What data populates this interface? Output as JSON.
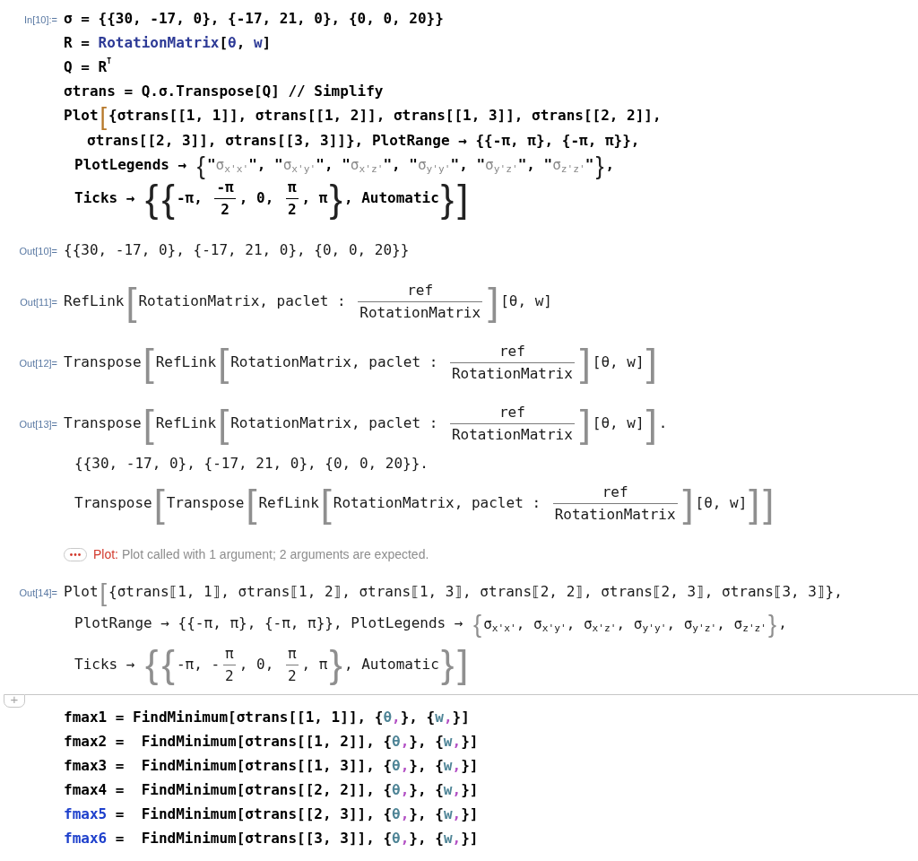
{
  "cells": [
    {
      "kind": "input",
      "label": "In[10]:=",
      "lines": [
        {
          "kind": "first",
          "segments": [
            {
              "kind": "code",
              "text": "σ = {{30, -17, 0}, {-17, 21, 0}, {0, 0, 20}}"
            }
          ]
        },
        {
          "kind": "first",
          "segments": [
            {
              "kind": "code",
              "text": "R = "
            },
            {
              "kind": "builtin",
              "text": "RotationMatrix"
            },
            {
              "kind": "code",
              "text": "["
            },
            {
              "kind": "symbol",
              "text": "θ"
            },
            {
              "kind": "code",
              "text": ", "
            },
            {
              "kind": "symbol",
              "text": "w"
            },
            {
              "kind": "code",
              "text": "]"
            }
          ]
        },
        {
          "kind": "first",
          "segments": [
            {
              "kind": "code",
              "text": "Q = R$^{T}$"
            }
          ]
        },
        {
          "kind": "first",
          "segments": [
            {
              "kind": "code",
              "text": "σtrans = Q.σ.Transpose[Q] // Simplify"
            }
          ]
        },
        {
          "kind": "first",
          "segments": [
            {
              "kind": "code",
              "text": "Plot"
            },
            {
              "kind": "match",
              "text": "["
            },
            {
              "kind": "code",
              "text": "{σtrans[[1, 1]], σtrans[[1, 2]], σtrans[[1, 3]], σtrans[[2, 2]],"
            }
          ]
        },
        {
          "kind": "deep",
          "segments": [
            {
              "kind": "code",
              "text": "σtrans[[2, 3]], σtrans[[3, 3]]}, PlotRange → {{-π, π}, {-π, π}},"
            }
          ]
        },
        {
          "kind": "wrap",
          "segments": [
            {
              "kind": "code",
              "text": "PlotLegends → "
            },
            {
              "kind": "bracket",
              "text": "{"
            },
            {
              "kind": "code",
              "text": "\""
            },
            {
              "kind": "string",
              "text": "σ$_{x'x'}$"
            },
            {
              "kind": "code",
              "text": "\", \""
            },
            {
              "kind": "string",
              "text": "σ$_{x'y'}$"
            },
            {
              "kind": "code",
              "text": "\", \""
            },
            {
              "kind": "string",
              "text": "σ$_{x'z'}$"
            },
            {
              "kind": "code",
              "text": "\", \""
            },
            {
              "kind": "string",
              "text": "σ$_{y'y'}$"
            },
            {
              "kind": "code",
              "text": "\", \""
            },
            {
              "kind": "string",
              "text": "σ$_{y'z'}$"
            },
            {
              "kind": "code",
              "text": "\", \""
            },
            {
              "kind": "string",
              "text": "σ$_{z'z'}$"
            },
            {
              "kind": "code",
              "text": "\""
            },
            {
              "kind": "bracket",
              "text": "}"
            },
            {
              "kind": "code",
              "text": ","
            }
          ]
        },
        {
          "kind": "wrap",
          "segments": [
            {
              "kind": "code",
              "text": "Ticks → "
            },
            {
              "kind": "bracket",
              "text": "{"
            },
            {
              "kind": "bracket",
              "text": "{"
            },
            {
              "kind": "code",
              "text": "-π, "
            },
            {
              "kind": "frac",
              "numerator": "-π",
              "denominator": "2"
            },
            {
              "kind": "code",
              "text": ", 0, "
            },
            {
              "kind": "frac",
              "numerator": "π",
              "denominator": "2"
            },
            {
              "kind": "code",
              "text": ", π"
            },
            {
              "kind": "bracket",
              "text": "}"
            },
            {
              "kind": "code",
              "text": ", Automatic"
            },
            {
              "kind": "bracket",
              "text": "}"
            },
            {
              "kind": "bracket",
              "text": "]"
            }
          ]
        }
      ]
    },
    {
      "kind": "output",
      "label": "Out[10]=",
      "lines": [
        {
          "kind": "first",
          "segments": [
            {
              "kind": "code",
              "text": "{{30, -17, 0}, {-17, 21, 0}, {0, 0, 20}}"
            }
          ]
        }
      ]
    },
    {
      "kind": "output",
      "label": "Out[11]=",
      "lines": [
        {
          "kind": "first",
          "segments": [
            {
              "kind": "code",
              "text": "RefLink"
            },
            {
              "kind": "bracket",
              "text": "["
            },
            {
              "kind": "code",
              "text": "RotationMatrix, paclet : "
            },
            {
              "kind": "frac",
              "numerator": "ref",
              "denominator": "RotationMatrix"
            },
            {
              "kind": "bracket",
              "text": "]"
            },
            {
              "kind": "code",
              "text": "[θ, w]"
            }
          ]
        }
      ]
    },
    {
      "kind": "output",
      "label": "Out[12]=",
      "lines": [
        {
          "kind": "first",
          "segments": [
            {
              "kind": "code",
              "text": "Transpose"
            },
            {
              "kind": "bracket",
              "text": "["
            },
            {
              "kind": "code",
              "text": "RefLink"
            },
            {
              "kind": "bracket",
              "text": "["
            },
            {
              "kind": "code",
              "text": "RotationMatrix, paclet : "
            },
            {
              "kind": "frac",
              "numerator": "ref",
              "denominator": "RotationMatrix"
            },
            {
              "kind": "bracket",
              "text": "]"
            },
            {
              "kind": "code",
              "text": "[θ, w]"
            },
            {
              "kind": "bracket",
              "text": "]"
            }
          ]
        }
      ]
    },
    {
      "kind": "output",
      "label": "Out[13]=",
      "lines": [
        {
          "kind": "first",
          "segments": [
            {
              "kind": "code",
              "text": "Transpose"
            },
            {
              "kind": "bracket",
              "text": "["
            },
            {
              "kind": "code",
              "text": "RefLink"
            },
            {
              "kind": "bracket",
              "text": "["
            },
            {
              "kind": "code",
              "text": "RotationMatrix, paclet : "
            },
            {
              "kind": "frac",
              "numerator": "ref",
              "denominator": "RotationMatrix"
            },
            {
              "kind": "bracket",
              "text": "]"
            },
            {
              "kind": "code",
              "text": "[θ, w]"
            },
            {
              "kind": "bracket",
              "text": "]"
            },
            {
              "kind": "code",
              "text": "."
            }
          ]
        },
        {
          "kind": "wrap",
          "segments": [
            {
              "kind": "code",
              "text": "{{30, -17, 0}, {-17, 21, 0}, {0, 0, 20}}."
            }
          ]
        },
        {
          "kind": "wrap",
          "segments": [
            {
              "kind": "code",
              "text": "Transpose"
            },
            {
              "kind": "bracket",
              "text": "["
            },
            {
              "kind": "code",
              "text": "Transpose"
            },
            {
              "kind": "bracket",
              "text": "["
            },
            {
              "kind": "code",
              "text": "RefLink"
            },
            {
              "kind": "bracket",
              "text": "["
            },
            {
              "kind": "code",
              "text": "RotationMatrix, paclet : "
            },
            {
              "kind": "frac",
              "numerator": "ref",
              "denominator": "RotationMatrix"
            },
            {
              "kind": "bracket",
              "text": "]"
            },
            {
              "kind": "code",
              "text": "[θ, w]"
            },
            {
              "kind": "bracket",
              "text": "]"
            },
            {
              "kind": "bracket",
              "text": "]"
            }
          ]
        }
      ]
    },
    {
      "kind": "message",
      "symbol": "Plot:",
      "text": "Plot called with 1 argument; 2 arguments are expected."
    },
    {
      "kind": "output",
      "label": "Out[14]=",
      "lines": [
        {
          "kind": "first",
          "segments": [
            {
              "kind": "code",
              "text": "Plot"
            },
            {
              "kind": "bracket",
              "text": "["
            },
            {
              "kind": "code",
              "text": "{σtrans⟦1, 1⟧, σtrans⟦1, 2⟧, σtrans⟦1, 3⟧, σtrans⟦2, 2⟧, σtrans⟦2, 3⟧, σtrans⟦3, 3⟧},"
            }
          ]
        },
        {
          "kind": "wrap",
          "segments": [
            {
              "kind": "code",
              "text": "PlotRange → {{-π, π}, {-π, π}}, PlotLegends → "
            },
            {
              "kind": "bracket",
              "text": "{"
            },
            {
              "kind": "code",
              "text": "σ$_{x'x'}$, σ$_{x'y'}$, σ$_{x'z'}$, σ$_{y'y'}$, σ$_{y'z'}$, σ$_{z'z'}$"
            },
            {
              "kind": "bracket",
              "text": "}"
            },
            {
              "kind": "code",
              "text": ","
            }
          ]
        },
        {
          "kind": "wrap",
          "segments": [
            {
              "kind": "code",
              "text": "Ticks → "
            },
            {
              "kind": "bracket",
              "text": "{"
            },
            {
              "kind": "bracket",
              "text": "{"
            },
            {
              "kind": "code",
              "text": "-π, -"
            },
            {
              "kind": "frac",
              "numerator": "π",
              "denominator": "2"
            },
            {
              "kind": "code",
              "text": ", 0, "
            },
            {
              "kind": "frac",
              "numerator": "π",
              "denominator": "2"
            },
            {
              "kind": "code",
              "text": ", π"
            },
            {
              "kind": "bracket",
              "text": "}"
            },
            {
              "kind": "code",
              "text": ", Automatic"
            },
            {
              "kind": "bracket",
              "text": "}"
            },
            {
              "kind": "bracket",
              "text": "]"
            }
          ]
        }
      ]
    },
    {
      "kind": "insertion",
      "button": "+"
    },
    {
      "kind": "input",
      "lines": [
        {
          "kind": "first",
          "segments": [
            {
              "kind": "code",
              "text": "fmax1 = FindMinimum[σtrans[[1, 1]], {"
            },
            {
              "kind": "local",
              "text": "θ"
            },
            {
              "kind": "punct",
              "text": ","
            },
            {
              "kind": "code",
              "text": "}, {"
            },
            {
              "kind": "local",
              "text": "w"
            },
            {
              "kind": "punct",
              "text": ","
            },
            {
              "kind": "code",
              "text": "}]"
            }
          ]
        },
        {
          "kind": "first",
          "segments": [
            {
              "kind": "code",
              "text": "fmax2 =  FindMinimum[σtrans[[1, 2]], {"
            },
            {
              "kind": "local",
              "text": "θ"
            },
            {
              "kind": "punct",
              "text": ","
            },
            {
              "kind": "code",
              "text": "}, {"
            },
            {
              "kind": "local",
              "text": "w"
            },
            {
              "kind": "punct",
              "text": ","
            },
            {
              "kind": "code",
              "text": "}]"
            }
          ]
        },
        {
          "kind": "first",
          "segments": [
            {
              "kind": "code",
              "text": "fmax3 =  FindMinimum[σtrans[[1, 3]], {"
            },
            {
              "kind": "local",
              "text": "θ"
            },
            {
              "kind": "punct",
              "text": ","
            },
            {
              "kind": "code",
              "text": "}, {"
            },
            {
              "kind": "local",
              "text": "w"
            },
            {
              "kind": "punct",
              "text": ","
            },
            {
              "kind": "code",
              "text": "}]"
            }
          ]
        },
        {
          "kind": "first",
          "segments": [
            {
              "kind": "code",
              "text": "fmax4 =  FindMinimum[σtrans[[2, 2]], {"
            },
            {
              "kind": "local",
              "text": "θ"
            },
            {
              "kind": "punct",
              "text": ","
            },
            {
              "kind": "code",
              "text": "}, {"
            },
            {
              "kind": "local",
              "text": "w"
            },
            {
              "kind": "punct",
              "text": ","
            },
            {
              "kind": "code",
              "text": "}]"
            }
          ]
        },
        {
          "kind": "first",
          "segments": [
            {
              "kind": "global",
              "text": "fmax5"
            },
            {
              "kind": "code",
              "text": " =  FindMinimum[σtrans[[2, 3]], {"
            },
            {
              "kind": "local",
              "text": "θ"
            },
            {
              "kind": "punct",
              "text": ","
            },
            {
              "kind": "code",
              "text": "}, {"
            },
            {
              "kind": "local",
              "text": "w"
            },
            {
              "kind": "punct",
              "text": ","
            },
            {
              "kind": "code",
              "text": "}]"
            }
          ]
        },
        {
          "kind": "first",
          "segments": [
            {
              "kind": "global",
              "text": "fmax6"
            },
            {
              "kind": "code",
              "text": " =  FindMinimum[σtrans[[3, 3]], {"
            },
            {
              "kind": "local",
              "text": "θ"
            },
            {
              "kind": "punct",
              "text": ","
            },
            {
              "kind": "code",
              "text": "}, {"
            },
            {
              "kind": "local",
              "text": "w"
            },
            {
              "kind": "punct",
              "text": ","
            },
            {
              "kind": "code",
              "text": "}]"
            }
          ]
        }
      ]
    }
  ]
}
